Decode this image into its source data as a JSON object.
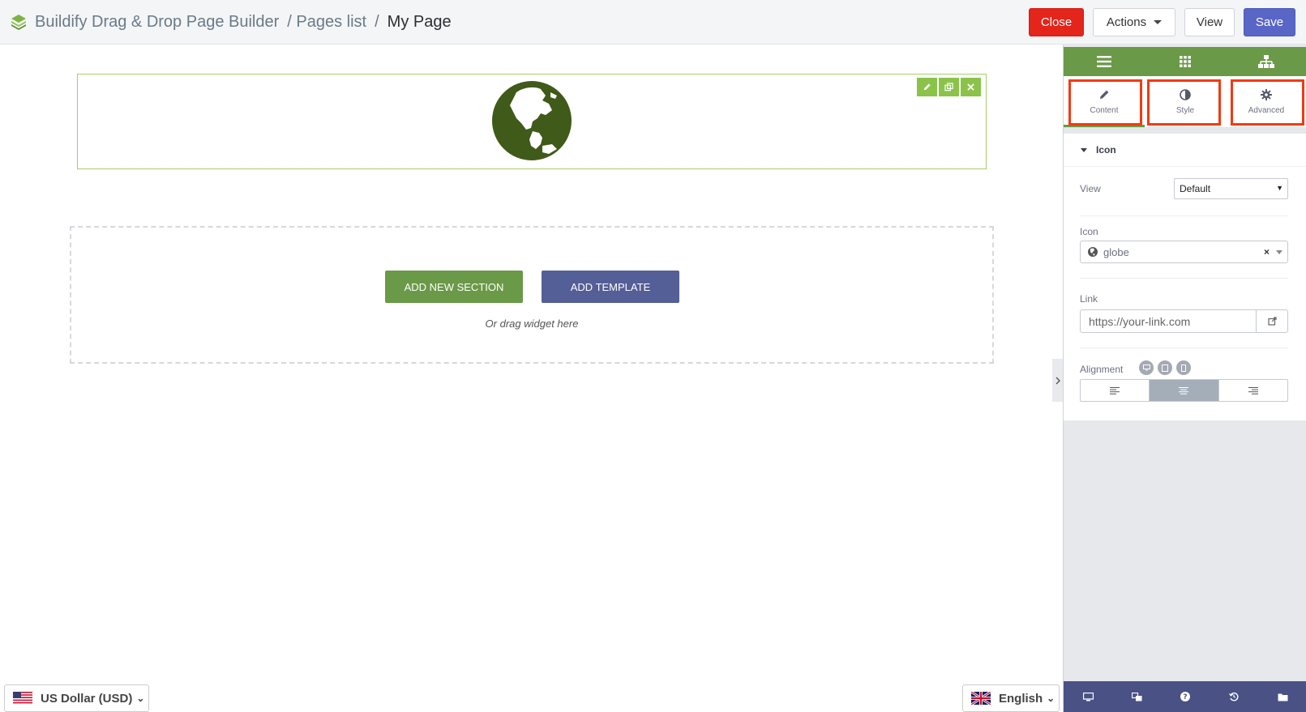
{
  "header": {
    "app_title": "Buildify Drag & Drop Page Builder",
    "crumb_pages": "/ Pages list",
    "crumb_separator": "/",
    "current_page": "My Page",
    "buttons": {
      "close": "Close",
      "actions": "Actions",
      "view": "View",
      "save": "Save"
    }
  },
  "canvas": {
    "widget_icon": "globe-icon",
    "add_section_label": "ADD NEW SECTION",
    "add_template_label": "ADD TEMPLATE",
    "drag_hint": "Or drag widget here",
    "currency": "US Dollar (USD)",
    "language": "English"
  },
  "panel": {
    "tabs": [
      {
        "label": "Content",
        "icon": "pencil-icon",
        "active": true
      },
      {
        "label": "Style",
        "icon": "contrast-icon",
        "active": false
      },
      {
        "label": "Advanced",
        "icon": "gear-icon",
        "active": false
      }
    ],
    "section_title": "Icon",
    "view_label": "View",
    "view_value": "Default",
    "icon_label": "Icon",
    "icon_value": "globe",
    "link_label": "Link",
    "link_placeholder": "https://your-link.com",
    "alignment_label": "Alignment",
    "alignment_options": [
      "left",
      "center",
      "right"
    ],
    "alignment_selected": "center"
  },
  "colors": {
    "brand_green": "#6a9947",
    "template_purple": "#545e97",
    "close_red": "#e3251b",
    "save_blue": "#5a66c6",
    "footer_navy": "#495185",
    "highlight_red": "#f23a11",
    "globe_dark": "#3f5a19"
  }
}
